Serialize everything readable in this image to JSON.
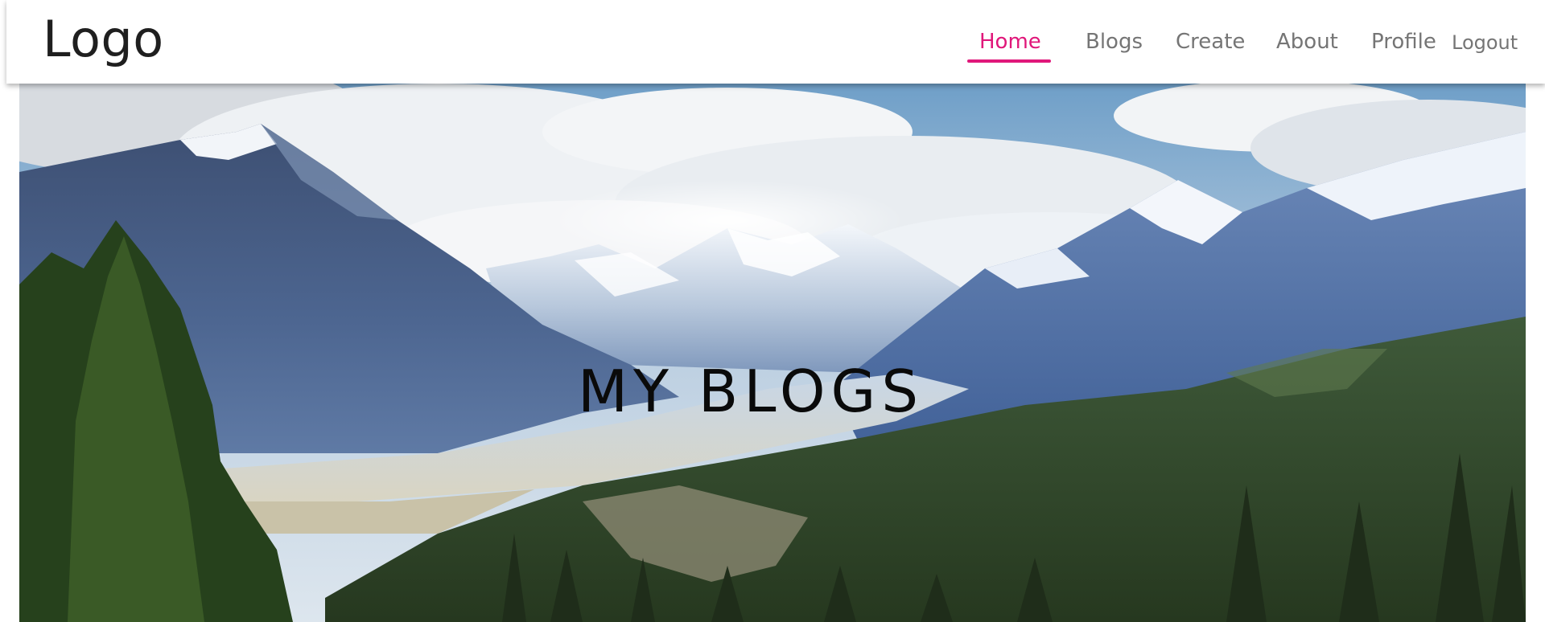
{
  "header": {
    "logo_text": "Logo",
    "nav": [
      {
        "label": "Home",
        "active": true
      },
      {
        "label": "Blogs",
        "active": false
      },
      {
        "label": "Create",
        "active": false
      },
      {
        "label": "About",
        "active": false
      },
      {
        "label": "Profile",
        "active": false
      }
    ],
    "logout_label": "Logout",
    "accent_color": "#e0177a"
  },
  "hero": {
    "title": "MY BLOGS"
  }
}
